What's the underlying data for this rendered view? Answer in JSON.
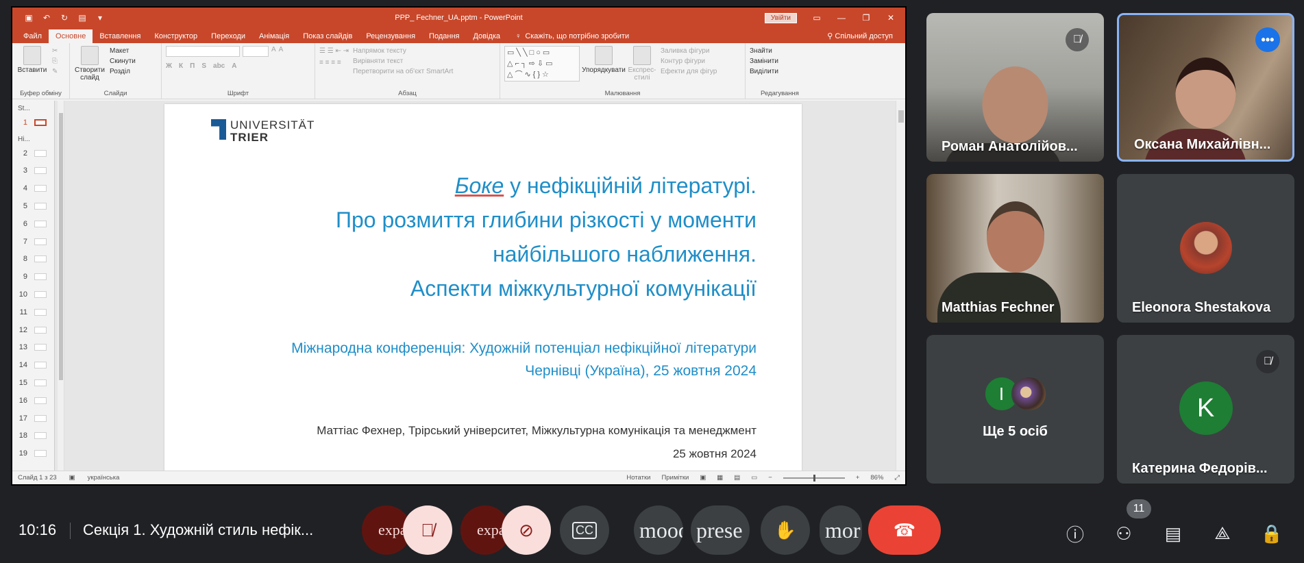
{
  "ppt": {
    "doc_title": "PPP_ Fechner_UA.pptm - PowerPoint",
    "signin": "Увійти",
    "tabs": [
      "Файл",
      "Основне",
      "Вставлення",
      "Конструктор",
      "Переходи",
      "Анімація",
      "Показ слайдів",
      "Рецензування",
      "Подання",
      "Довідка"
    ],
    "active_tab": "Основне",
    "tell_me": "Скажіть, що потрібно зробити",
    "share": "Спільний доступ",
    "ribbon": {
      "paste": "Вставити",
      "clipboard_label": "Буфер обміну",
      "new_slide": "Створити слайд",
      "layout": "Макет",
      "reset": "Скинути",
      "section": "Розділ",
      "slides_label": "Слайди",
      "font_label": "Шрифт",
      "text_direction": "Напрямок тексту",
      "align_text": "Вирівняти текст",
      "smartart": "Перетворити на об'єкт SmartArt",
      "paragraph_label": "Абзац",
      "arrange": "Упорядкувати",
      "quick_styles": "Експрес-стилі",
      "shape_fill": "Заливка фігури",
      "shape_outline": "Контур фігури",
      "shape_effects": "Ефекти для фігур",
      "drawing_label": "Малювання",
      "find": "Знайти",
      "replace": "Замінити",
      "select": "Виділити",
      "editing_label": "Редагування"
    },
    "thumbs": {
      "section1": "St...",
      "section2": "Hi...",
      "numbers": [
        "1",
        "2",
        "3",
        "4",
        "5",
        "6",
        "7",
        "8",
        "9",
        "10",
        "11",
        "12",
        "13",
        "14",
        "15",
        "16",
        "17",
        "18",
        "19"
      ]
    },
    "slide": {
      "logo_line1": "UNIVERSITÄT",
      "logo_line2": "TRIER",
      "title_italic": "Боке",
      "title_line1_rest": " у нефікційній літературі.",
      "title_line2": "Про розмиття глибини різкості у моменти",
      "title_line3": "найбільшого наближення.",
      "title_line4": "Аспекти міжкультурної комунікації",
      "sub_line1": "Міжнародна конференція: Художній потенціал нефікційної літератури",
      "sub_line2": "Чернівці (Україна), 25 жовтня 2024",
      "author_line1": "Маттіас Фехнер, Трірський університет, Міжкультурна комунікація та менеджмент",
      "author_line2": "25 жовтня 2024"
    },
    "status": {
      "slide_of": "Слайд 1 з 23",
      "language": "українська",
      "notes": "Нотатки",
      "comments": "Примітки",
      "zoom": "86%"
    }
  },
  "participants": [
    {
      "name": "Роман Анатолійов...",
      "muted": true
    },
    {
      "name": "Оксана Михайлівн...",
      "speaking": true
    },
    {
      "name": "Matthias Fechner",
      "muted": false
    },
    {
      "name": "Eleonora Shestakova",
      "muted": false
    },
    {
      "label": "Ще 5 осіб",
      "avatar_letter": "I"
    },
    {
      "name": "Катерина Федорів...",
      "avatar_letter": "K",
      "muted": true
    }
  ],
  "bottombar": {
    "time": "10:16",
    "meeting_title": "Секція 1. Художній стиль нефік...",
    "expand_label_1": "expa",
    "expand_label_2": "expa",
    "mood_label": "mood",
    "present_label": "prese",
    "more_label": "mor",
    "people_count": "11"
  }
}
